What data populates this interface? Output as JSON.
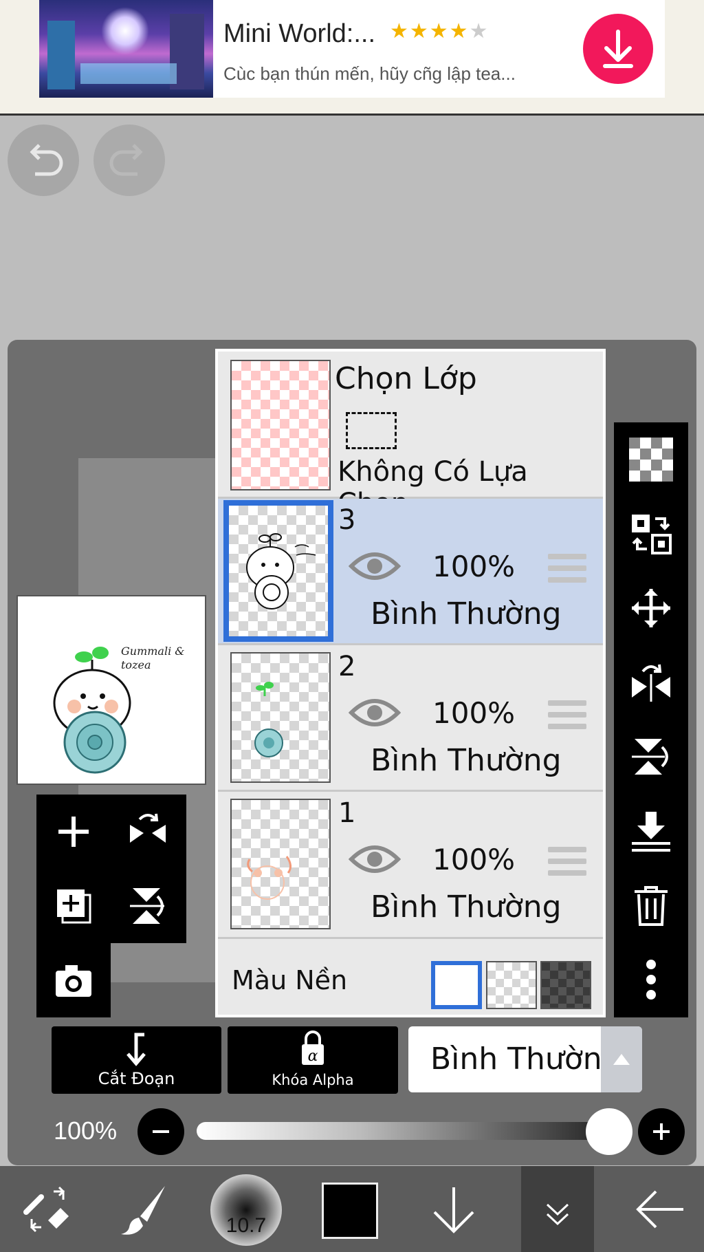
{
  "ad": {
    "title": "Mini World:...",
    "subtitle": "Cùc bạn thún mến, hũy cñg lập tea...",
    "rating": 4,
    "rating_max": 5,
    "accent": "#f2185b"
  },
  "layers": {
    "selection": {
      "title": "Chọn Lớp",
      "status": "Không Có Lựa Chọn"
    },
    "items": [
      {
        "number": "3",
        "opacity": "100%",
        "mode": "Bình Thường",
        "selected": true
      },
      {
        "number": "2",
        "opacity": "100%",
        "mode": "Bình Thường",
        "selected": false
      },
      {
        "number": "1",
        "opacity": "100%",
        "mode": "Bình Thường",
        "selected": false
      }
    ],
    "background": {
      "label": "Màu Nền"
    }
  },
  "options": {
    "clip_label": "Cắt Đoạn",
    "alpha_lock_label": "Khóa Alpha",
    "blend_mode": "Bình Thường"
  },
  "opacity": {
    "value": "100%",
    "level": 1.0
  },
  "bottom": {
    "brush_size": "10.7",
    "color": "#000000"
  },
  "colors": {
    "selected_layer": "#c9d6ec",
    "selected_border": "#2f6fd8"
  },
  "preview_art": {
    "signature": "Gummali & tozea"
  }
}
